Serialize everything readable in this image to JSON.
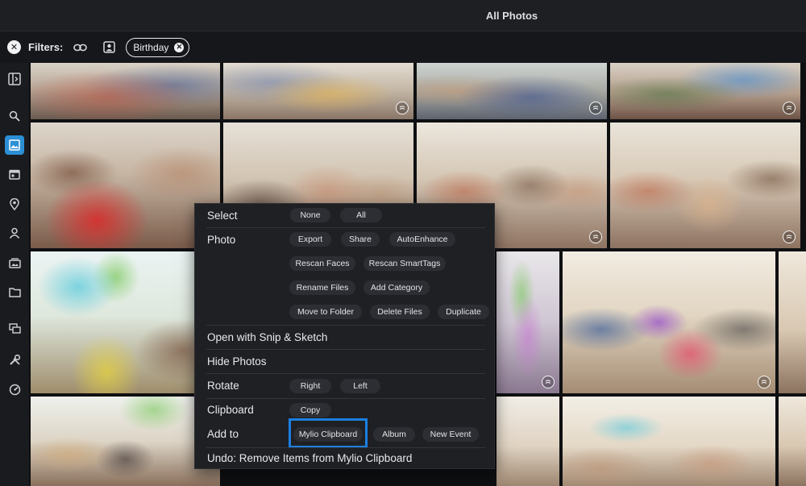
{
  "window": {
    "title": "All Photos"
  },
  "filters": {
    "label": "Filters:",
    "chip_label": "Birthday"
  },
  "menu": {
    "select": {
      "label": "Select",
      "none": "None",
      "all": "All"
    },
    "photo": {
      "label": "Photo",
      "export": "Export",
      "share": "Share",
      "auto_enhance": "AutoEnhance",
      "rescan_faces": "Rescan Faces",
      "rescan_smarttags": "Rescan SmartTags",
      "rename_files": "Rename Files",
      "add_category": "Add Category",
      "move_to_folder": "Move to Folder",
      "delete_files": "Delete Files",
      "duplicate": "Duplicate"
    },
    "open_with": "Open with Snip & Sketch",
    "hide_photos": "Hide Photos",
    "rotate": {
      "label": "Rotate",
      "right": "Right",
      "left": "Left"
    },
    "clipboard": {
      "label": "Clipboard",
      "copy": "Copy"
    },
    "add_to": {
      "label": "Add to",
      "mylio_clipboard": "Mylio Clipboard",
      "album": "Album",
      "new_event": "New Event"
    },
    "undo": "Undo: Remove Items from Mylio Clipboard"
  },
  "colors": {
    "accent": "#2c8fd6",
    "selection_outline": "#4aa3e6",
    "highlight_box": "#1b7fe0",
    "menu_bg": "#1f2024"
  },
  "icons": {
    "rail": [
      "panel-toggle-icon",
      "search-icon",
      "photos-icon",
      "calendar-icon",
      "map-pin-icon",
      "people-icon",
      "albums-icon",
      "folder-icon",
      "devices-icon",
      "tools-icon",
      "dashboard-icon"
    ],
    "filterbar": [
      "clear-filters-icon",
      "link-icon",
      "face-filter-icon",
      "remove-chip-icon"
    ]
  }
}
